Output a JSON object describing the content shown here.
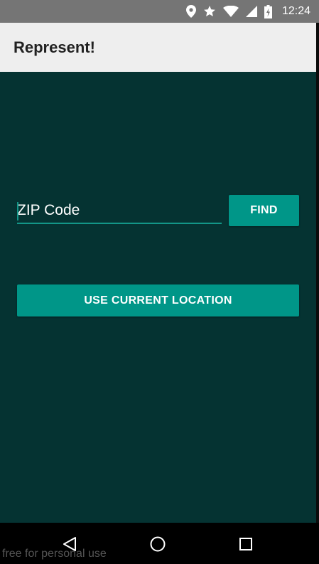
{
  "status_bar": {
    "time": "12:24",
    "icons": [
      "location-icon",
      "star-icon",
      "wifi-icon",
      "signal-icon",
      "battery-icon"
    ]
  },
  "app_bar": {
    "title": "Represent!"
  },
  "form": {
    "zip_placeholder": "ZIP Code",
    "zip_value": "",
    "find_label": "FIND",
    "location_label": "USE CURRENT LOCATION"
  },
  "nav_bar": {
    "buttons": [
      "back-icon",
      "home-icon",
      "recents-icon"
    ]
  },
  "watermark": "free for personal use",
  "colors": {
    "status_bar": "#757575",
    "app_bar": "#eeeeee",
    "background": "#053332",
    "accent": "#009688",
    "nav_bar": "#000000"
  }
}
